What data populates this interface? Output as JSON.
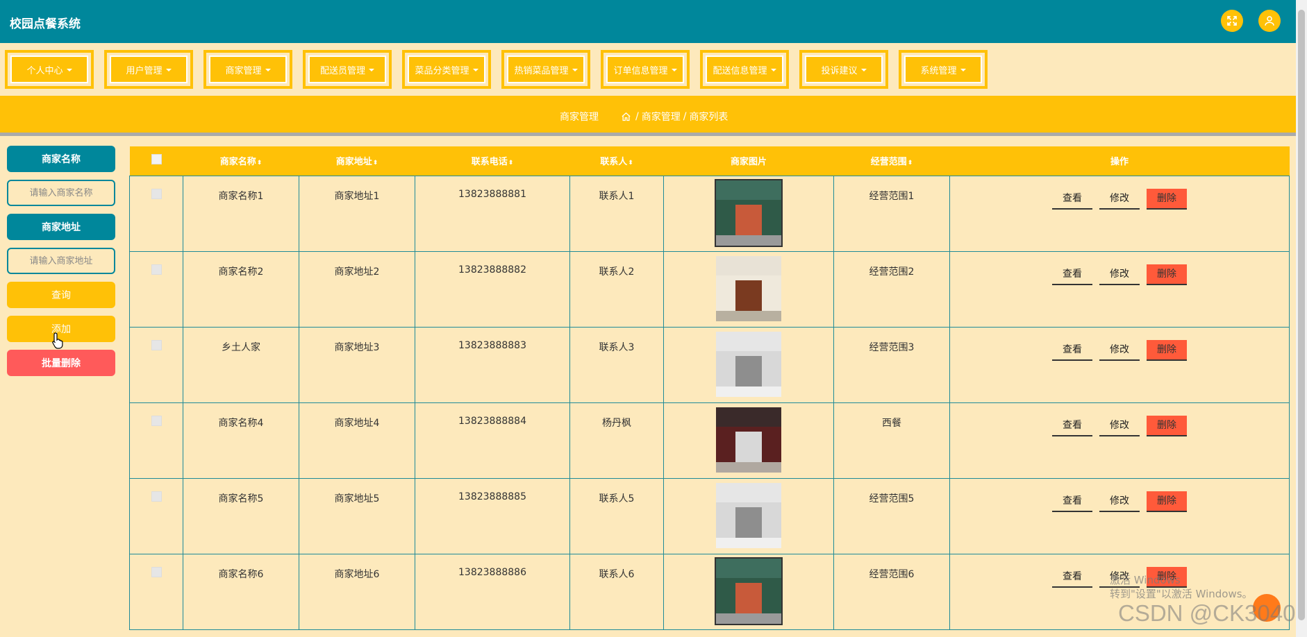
{
  "header": {
    "title": "校园点餐系统"
  },
  "menu": [
    {
      "label": "个人中心"
    },
    {
      "label": "用户管理"
    },
    {
      "label": "商家管理"
    },
    {
      "label": "配送员管理"
    },
    {
      "label": "菜品分类管理"
    },
    {
      "label": "热销菜品管理"
    },
    {
      "label": "订单信息管理"
    },
    {
      "label": "配送信息管理"
    },
    {
      "label": "投诉建议"
    },
    {
      "label": "系统管理"
    }
  ],
  "breadcrumb": {
    "title": "商家管理",
    "path": [
      "商家管理",
      "商家列表"
    ],
    "separator": "/"
  },
  "sidebar": {
    "name_label": "商家名称",
    "name_placeholder": "请输入商家名称",
    "address_label": "商家地址",
    "address_placeholder": "请输入商家地址",
    "query": "查询",
    "add": "添加",
    "batch_delete": "批量删除"
  },
  "table": {
    "columns": [
      "商家名称",
      "商家地址",
      "联系电话",
      "联系人",
      "商家图片",
      "经营范围",
      "操作"
    ],
    "actions": {
      "view": "查看",
      "edit": "修改",
      "delete": "删除"
    },
    "rows": [
      {
        "name": "商家名称1",
        "address": "商家地址1",
        "phone": "13823888881",
        "contact": "联系人1",
        "scope": "经营范围1",
        "image": "storefront-green"
      },
      {
        "name": "商家名称2",
        "address": "商家地址2",
        "phone": "13823888882",
        "contact": "联系人2",
        "scope": "经营范围2",
        "image": "storefront-white"
      },
      {
        "name": "乡土人家",
        "address": "商家地址3",
        "phone": "13823888883",
        "contact": "联系人3",
        "scope": "经营范围3",
        "image": "interior-grey"
      },
      {
        "name": "商家名称4",
        "address": "商家地址4",
        "phone": "13823888884",
        "contact": "杨丹枫",
        "scope": "西餐",
        "image": "storefront-dark"
      },
      {
        "name": "商家名称5",
        "address": "商家地址5",
        "phone": "13823888885",
        "contact": "联系人5",
        "scope": "经营范围5",
        "image": "interior-grey"
      },
      {
        "name": "商家名称6",
        "address": "商家地址6",
        "phone": "13823888886",
        "contact": "联系人6",
        "scope": "经营范围6",
        "image": "storefront-green"
      }
    ]
  },
  "overlay": {
    "activate_line1": "激活 Windows",
    "activate_line2": "转到\"设置\"以激活 Windows。",
    "csdn": "CSDN @CK3040"
  },
  "colors": {
    "header": "#00879b",
    "accent": "#ffc107",
    "background": "#fde9bc",
    "danger": "#ff5a3a"
  }
}
